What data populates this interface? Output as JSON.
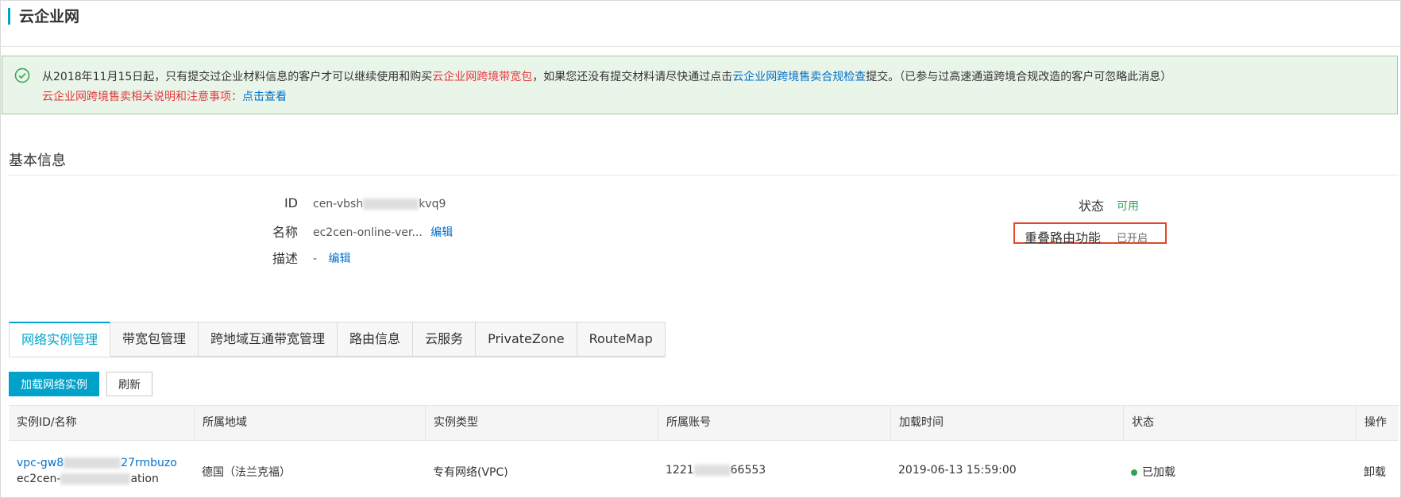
{
  "header": {
    "title": "云企业网"
  },
  "notice": {
    "line1_a": "从2018年11月15日起，只有提交过企业材料信息的客户才可以继续使用和购买",
    "line1_link1": "云企业网跨境带宽包",
    "line1_b": "，如果您还没有提交材料请尽快通过点击",
    "line1_link2": "云企业网跨境售卖合规检查",
    "line1_c": "提交。（已参与过高速通道跨境合规改造的客户可忽略此消息）",
    "line2_text": "云企业网跨境售卖相关说明和注意事项：",
    "line2_link": "点击查看",
    "accent": "#2fa34d"
  },
  "basic_info": {
    "section_title": "基本信息",
    "id_label": "ID",
    "id_prefix": "cen-vbsh",
    "id_suffix": "kvq9",
    "name_label": "名称",
    "name_value": "ec2cen-online-ver...",
    "edit_label": "编辑",
    "desc_label": "描述",
    "desc_value": "-",
    "status_label": "状态",
    "status_value": "可用",
    "overlap_label": "重叠路由功能",
    "overlap_value": "已开启"
  },
  "tabs": [
    {
      "label": "网络实例管理",
      "active": true
    },
    {
      "label": "带宽包管理"
    },
    {
      "label": "跨地域互通带宽管理"
    },
    {
      "label": "路由信息"
    },
    {
      "label": "云服务"
    },
    {
      "label": "PrivateZone"
    },
    {
      "label": "RouteMap"
    }
  ],
  "toolbar": {
    "load_label": "加载网络实例",
    "refresh_label": "刷新"
  },
  "table": {
    "columns": [
      "实例ID/名称",
      "所属地域",
      "实例类型",
      "所属账号",
      "加载时间",
      "状态",
      "操作"
    ],
    "rows": [
      {
        "id_prefix": "vpc-gw8",
        "id_suffix": "27rmbuzo",
        "name_prefix": "ec2cen-",
        "name_suffix": "ation",
        "region": "德国（法兰克福）",
        "type": "专有网络(VPC)",
        "account_prefix": "1221",
        "account_suffix": "66553",
        "time": "2019-06-13 15:59:00",
        "status": "已加载",
        "action": "卸载"
      }
    ]
  },
  "colors": {
    "brand": "#00a2ca",
    "link": "#0070cc",
    "success": "#2fa34d",
    "danger": "#e4393c",
    "highlight": "#e24626"
  }
}
